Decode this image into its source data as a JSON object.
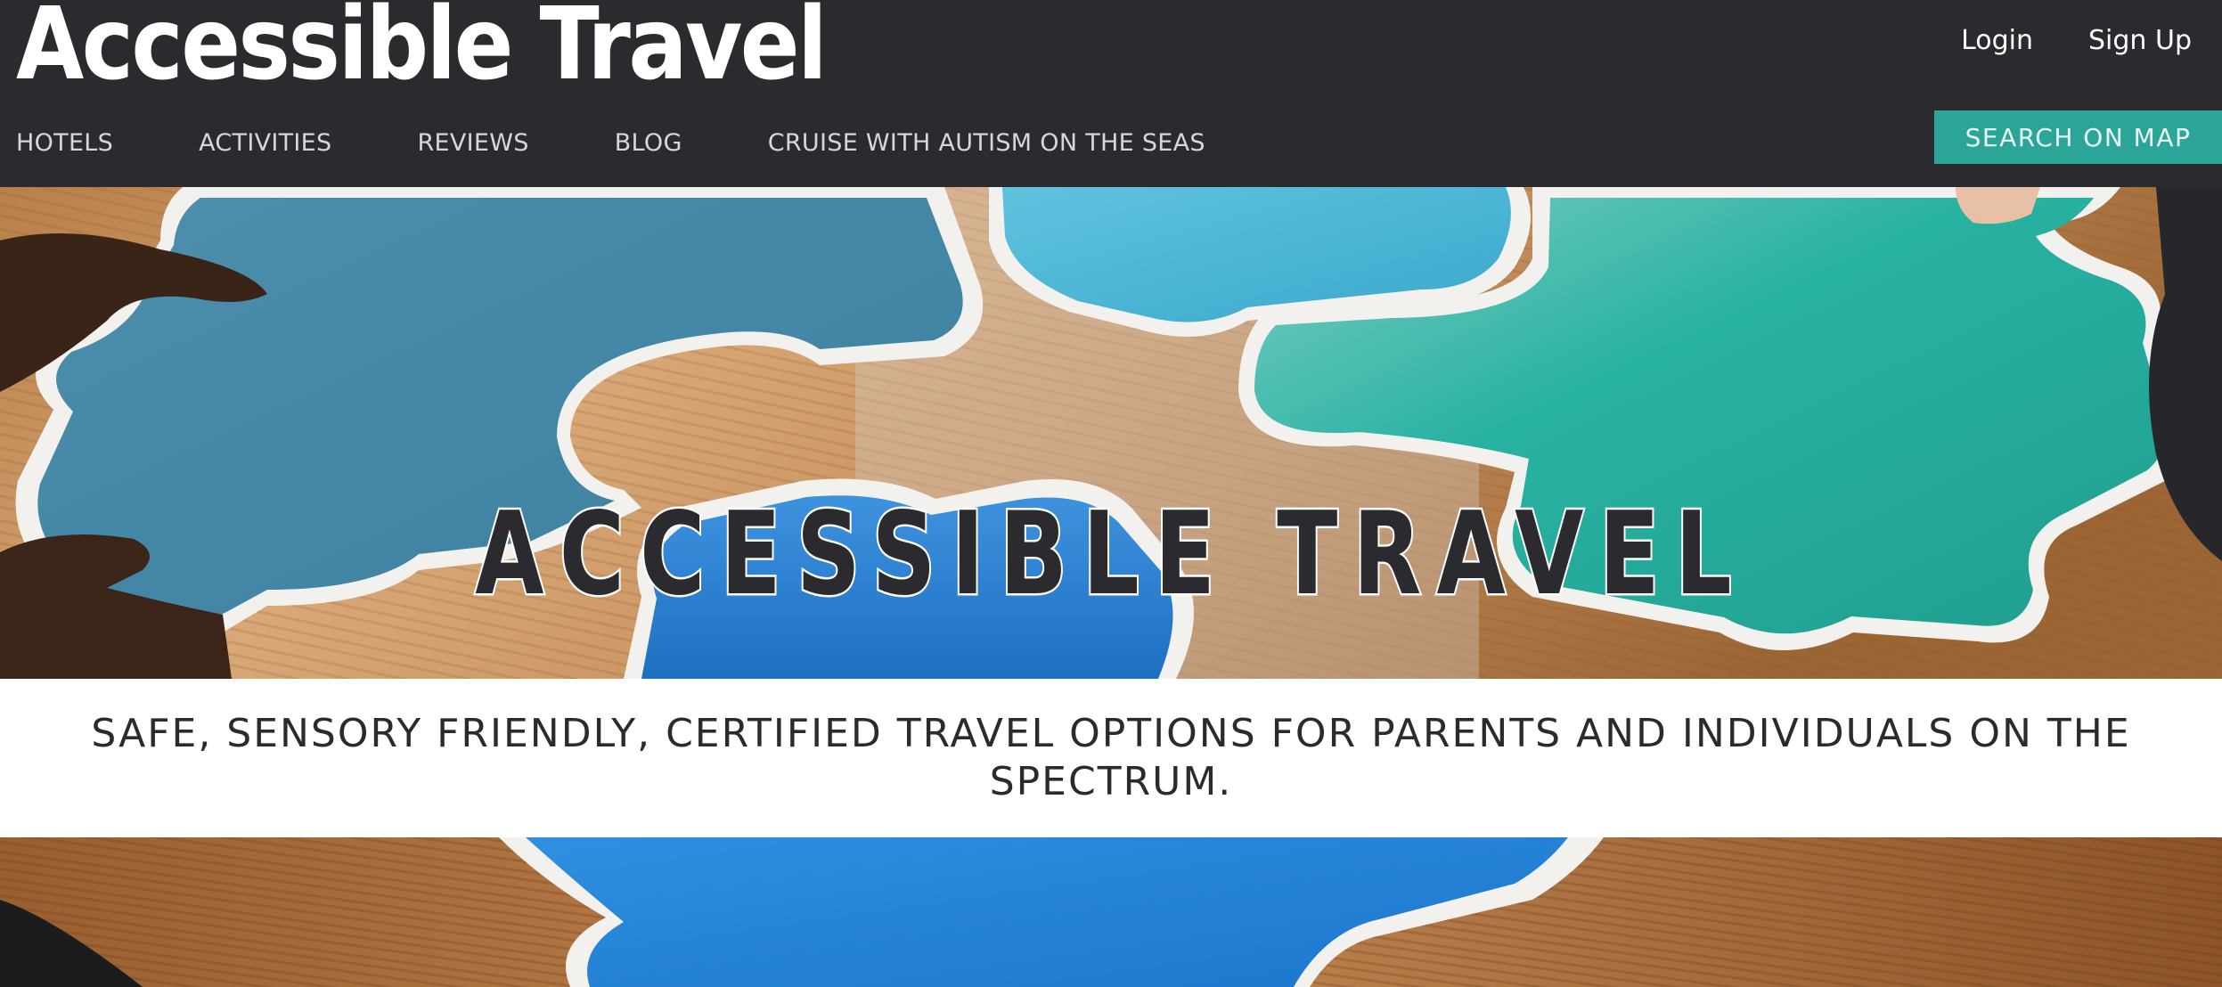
{
  "header": {
    "brand": "Accessible Travel",
    "auth": {
      "login": "Login",
      "signup": "Sign Up"
    },
    "nav": [
      "HOTELS",
      "ACTIVITIES",
      "REVIEWS",
      "BLOG",
      "CRUISE WITH AUTISM ON THE SEAS"
    ],
    "search_map_button": "SEARCH ON MAP"
  },
  "hero": {
    "title": "ACCESSIBLE TRAVEL"
  },
  "tagline": "SAFE, SENSORY FRIENDLY, CERTIFIED TRAVEL OPTIONS FOR PARENTS AND INDIVIDUALS ON THE SPECTRUM.",
  "colors": {
    "header_bg": "#2b2a2f",
    "accent": "#2aa597",
    "text_dark": "#2b2a2f"
  }
}
